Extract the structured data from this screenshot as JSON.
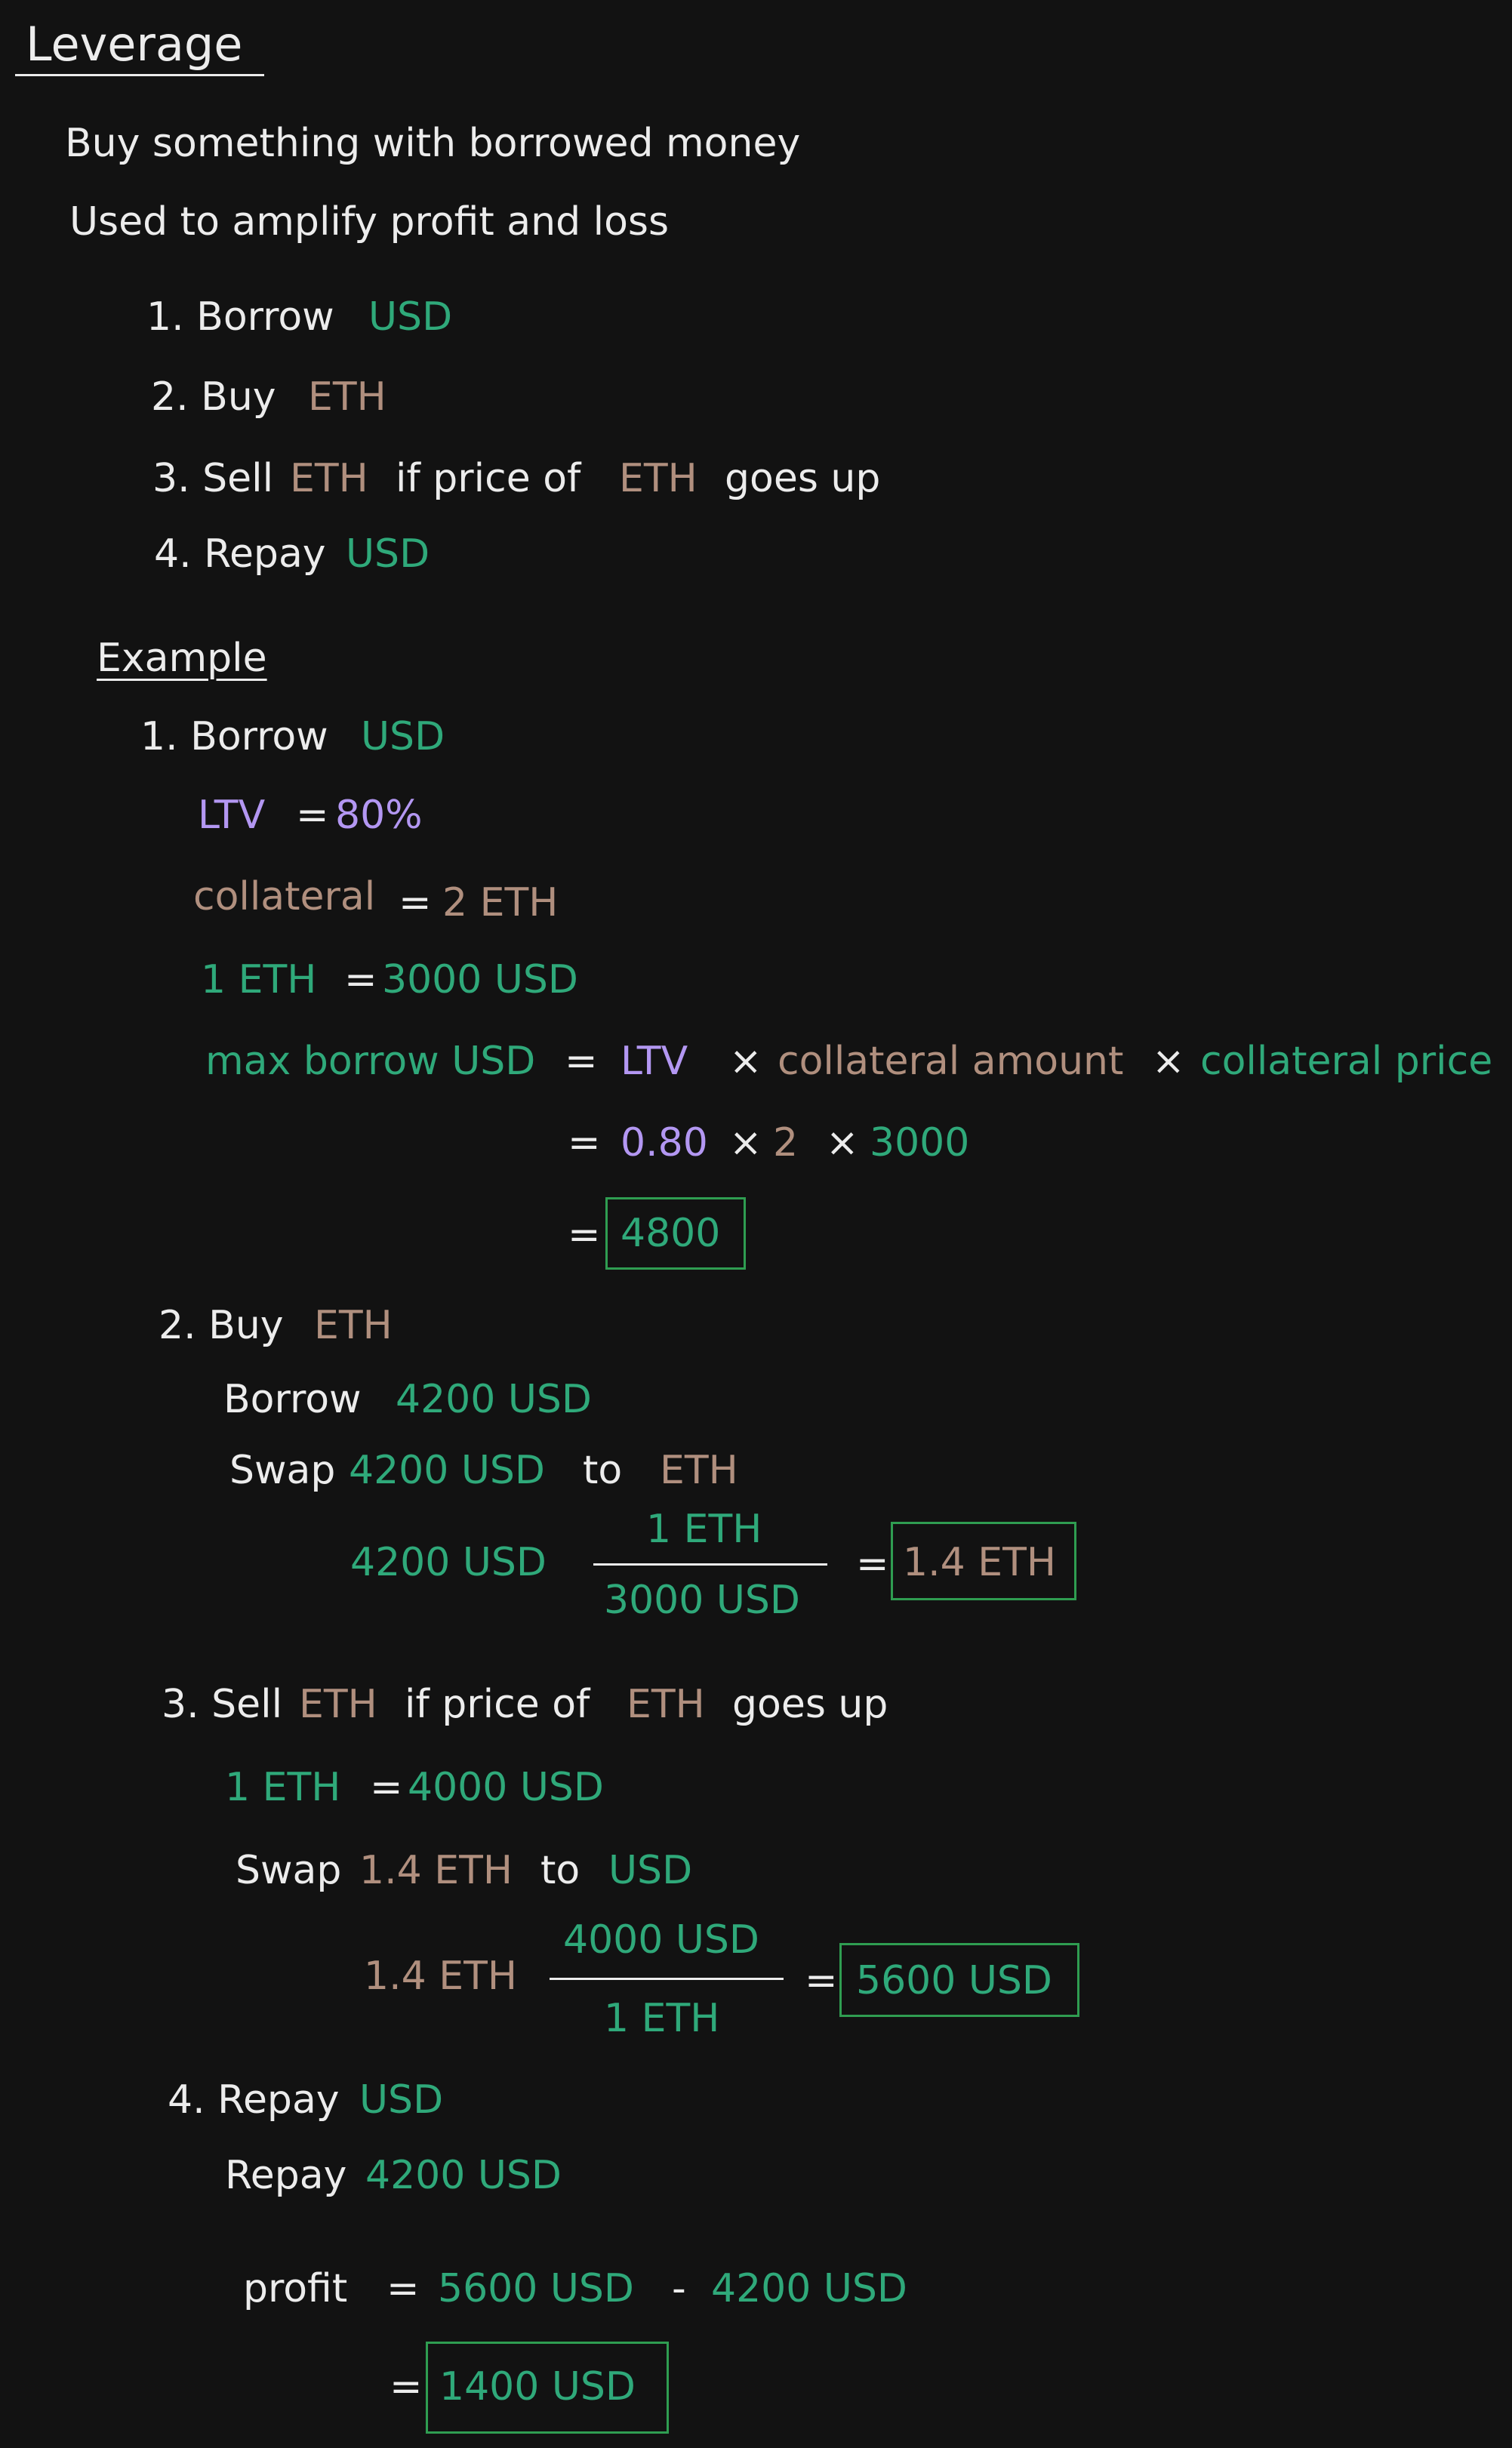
{
  "title": "Leverage",
  "intro": {
    "line1": "Buy something with borrowed money",
    "line2": "Used to amplify profit and loss"
  },
  "steps": {
    "s1_num": "1. Borrow",
    "s1_asset": "USD",
    "s2_num": "2. Buy",
    "s2_asset": "ETH",
    "s3_pre": "3. Sell",
    "s3_asset1": "ETH",
    "s3_mid": "if price of",
    "s3_asset2": "ETH",
    "s3_post": "goes up",
    "s4_num": "4. Repay",
    "s4_asset": "USD"
  },
  "example": {
    "heading": "Example",
    "e1": {
      "label": "1. Borrow",
      "asset": "USD",
      "ltv_label": "LTV",
      "eq": "=",
      "ltv_value": "80%",
      "collateral_label": "collateral",
      "collateral_value": "2 ETH",
      "price_left": "1 ETH",
      "price_right": "3000 USD",
      "max_borrow_label": "max borrow USD",
      "formula_ltv": "LTV",
      "times": "×",
      "formula_amount": "collateral amount",
      "formula_price": "collateral price",
      "calc_ltv": "0.80",
      "calc_amount": "2",
      "calc_price": "3000",
      "result": "4800"
    },
    "e2": {
      "label": "2. Buy",
      "asset": "ETH",
      "borrow_label": "Borrow",
      "borrow_value": "4200 USD",
      "swap_label": "Swap",
      "swap_value": "4200 USD",
      "to": "to",
      "swap_target": "ETH",
      "calc_left": "4200 USD",
      "frac_num": "1 ETH",
      "frac_den": "3000 USD",
      "result": "1.4 ETH"
    },
    "e3": {
      "label_pre": "3. Sell",
      "asset1": "ETH",
      "label_mid": "if price of",
      "asset2": "ETH",
      "label_post": "goes up",
      "price_left": "1 ETH",
      "price_right": "4000 USD",
      "swap_label": "Swap",
      "swap_value": "1.4 ETH",
      "to": "to",
      "swap_target": "USD",
      "calc_left": "1.4 ETH",
      "frac_num": "4000 USD",
      "frac_den": "1 ETH",
      "result": "5600 USD"
    },
    "e4": {
      "label": "4. Repay",
      "asset": "USD",
      "repay_label": "Repay",
      "repay_value": "4200 USD",
      "profit_label": "profit",
      "profit_a": "5600 USD",
      "minus": "-",
      "profit_b": "4200 USD",
      "result": "1400 USD"
    }
  },
  "colors": {
    "background": "#121212",
    "text": "#ececec",
    "usd_green": "#2fa97a",
    "eth_brown": "#b08f7e",
    "ltv_purple": "#b397f2",
    "box_green": "#2f9d51"
  }
}
